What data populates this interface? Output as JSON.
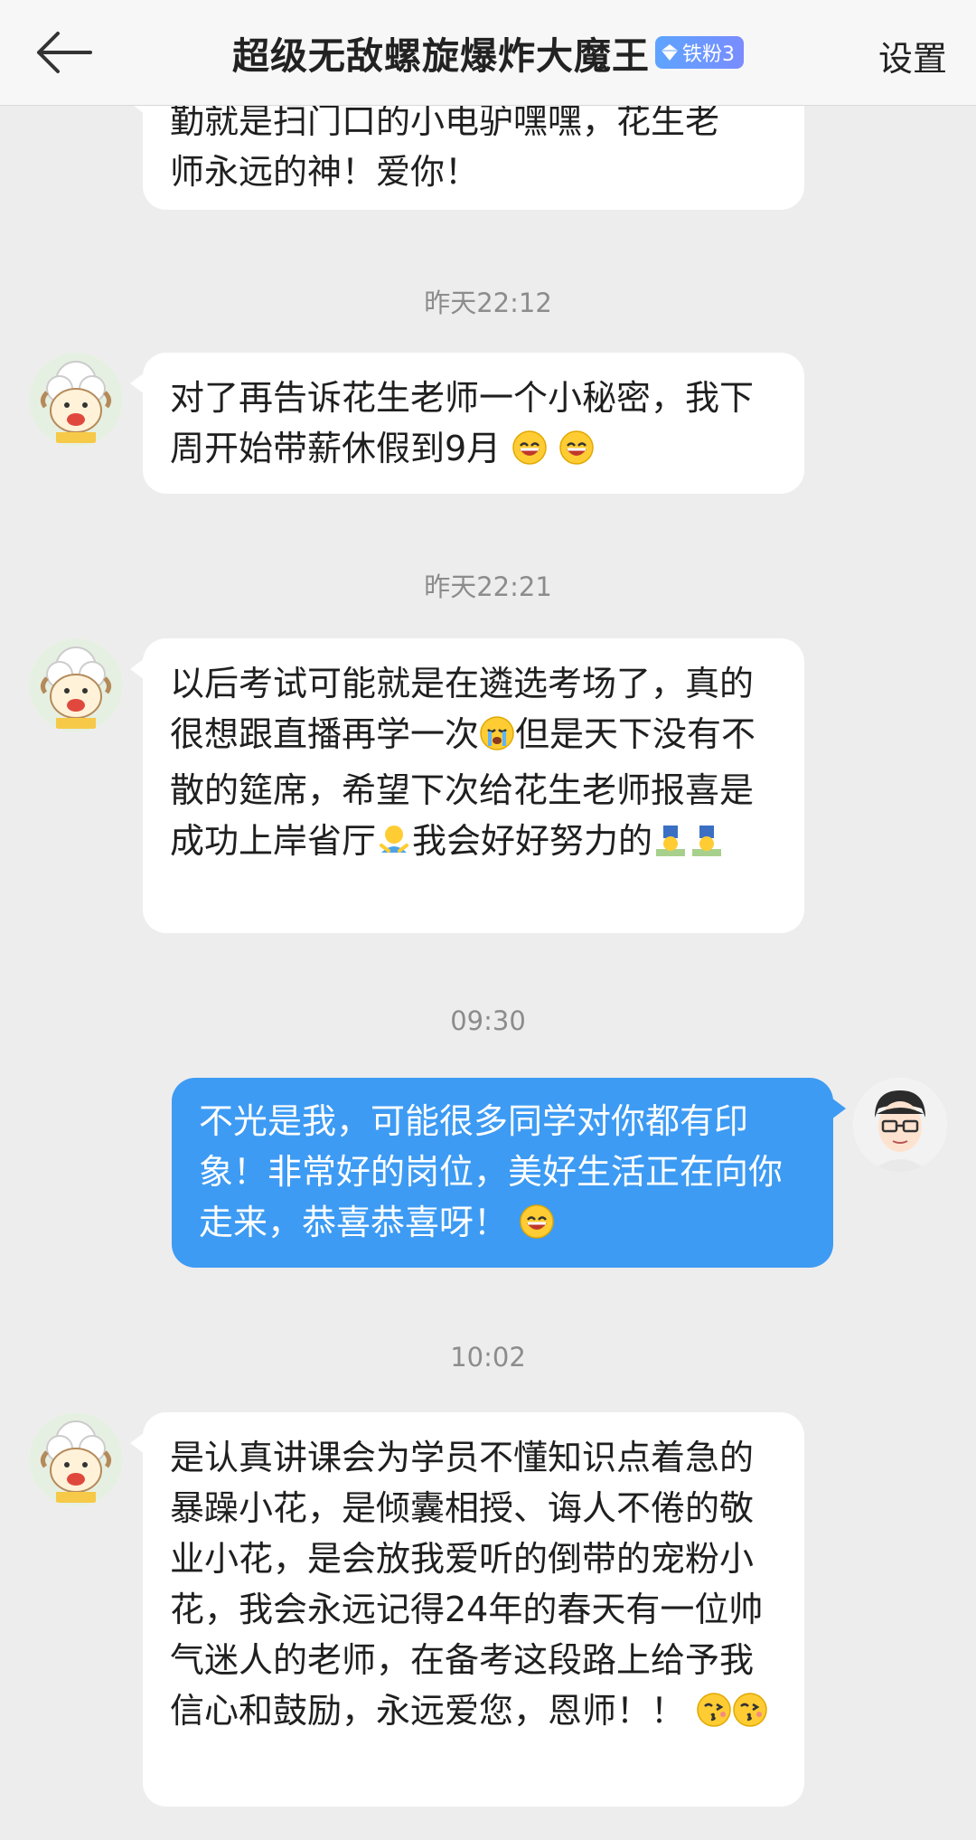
{
  "header": {
    "title": "超级无敌螺旋爆炸大魔王",
    "badge": "铁粉3",
    "settings": "设置"
  },
  "messages": [
    {
      "text_lines": [
        "勤就是扫门口的小电驴嘿嘿，花生老",
        "师永远的神！爱你！"
      ]
    },
    {
      "time": "昨天22:12",
      "text_a": "对了再告诉花生老师一个小秘密，我下周开始带薪休假到9月"
    },
    {
      "time": "昨天22:21",
      "text_a": "以后考试可能就是在遴选考场了，真的很想跟直播再学一次",
      "text_b": "但是天下没有不散的筵席，希望下次给花生老师报喜是成功上岸省厅",
      "text_c": "我会好好努力的"
    },
    {
      "time": "09:30",
      "text_a": "不光是我，可能很多同学对你都有印象！非常好的岗位，美好生活正在向你走来，恭喜恭喜呀！"
    },
    {
      "time": "10:02",
      "text_a": "是认真讲课会为学员不懂知识点着急的暴躁小花，是倾囊相授、诲人不倦的敬业小花，是会放我爱听的倒带的宠粉小花，我会永远记得24年的春天有一位帅气迷人的老师，在备考这段路上给予我信心和鼓励，永远爱您，恩师！！"
    }
  ]
}
